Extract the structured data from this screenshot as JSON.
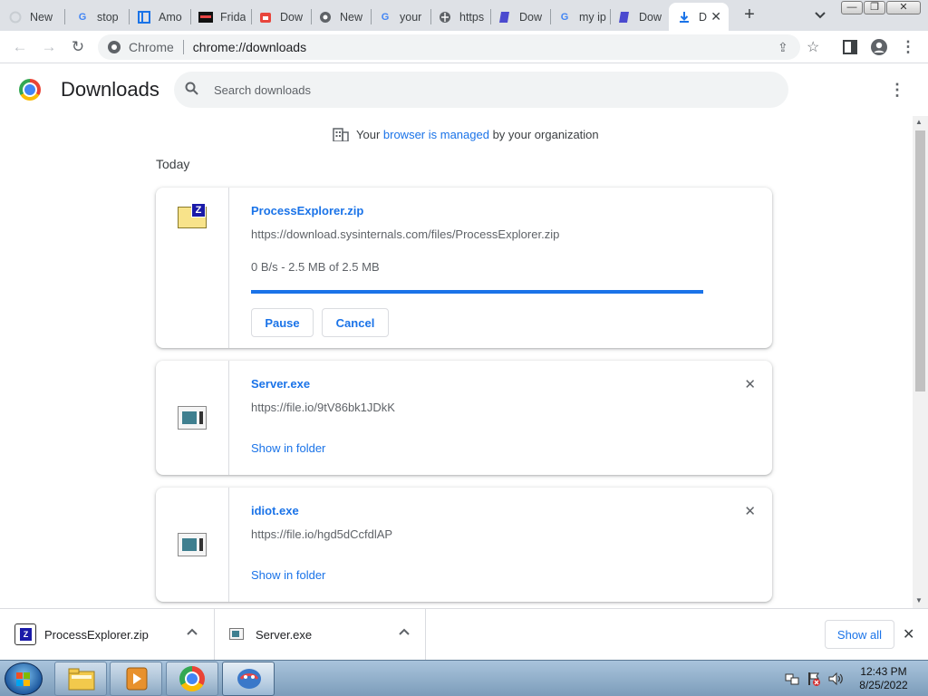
{
  "tabs": [
    {
      "title": "New",
      "icon": "loading-icon"
    },
    {
      "title": "stop",
      "icon": "google-icon"
    },
    {
      "title": "Amo",
      "icon": "window-icon"
    },
    {
      "title": "Frida",
      "icon": "frida-icon"
    },
    {
      "title": "Dow",
      "icon": "download-page-icon"
    },
    {
      "title": "New",
      "icon": "globe-icon"
    },
    {
      "title": "your",
      "icon": "google-icon"
    },
    {
      "title": "https",
      "icon": "globe-icon"
    },
    {
      "title": "Dow",
      "icon": "bookmark-icon"
    },
    {
      "title": "my ip",
      "icon": "google-icon"
    },
    {
      "title": "Dow",
      "icon": "bookmark-icon"
    },
    {
      "title": "D",
      "icon": "download-icon",
      "active": true
    }
  ],
  "toolbar": {
    "site_chip": "Chrome",
    "url": "chrome://downloads"
  },
  "header": {
    "title": "Downloads",
    "search_placeholder": "Search downloads"
  },
  "managed": {
    "prefix": "Your ",
    "link": "browser is managed",
    "suffix": " by your organization"
  },
  "section_label": "Today",
  "downloads": [
    {
      "name": "ProcessExplorer.zip",
      "url": "https://download.sysinternals.com/files/ProcessExplorer.zip",
      "status": "0 B/s - 2.5 MB of 2.5 MB",
      "progress": 1.0,
      "buttons": [
        "Pause",
        "Cancel"
      ]
    },
    {
      "name": "Server.exe",
      "url": "https://file.io/9tV86bk1JDkK",
      "action": "Show in folder"
    },
    {
      "name": "idiot.exe",
      "url": "https://file.io/hgd5dCcfdlAP",
      "action": "Show in folder"
    }
  ],
  "shelf": {
    "items": [
      "ProcessExplorer.zip",
      "Server.exe"
    ],
    "show_all": "Show all"
  },
  "clock": {
    "time": "12:43 PM",
    "date": "8/25/2022"
  },
  "colors": {
    "accent": "#1a73e8",
    "tabstrip": "#dee1e6"
  }
}
